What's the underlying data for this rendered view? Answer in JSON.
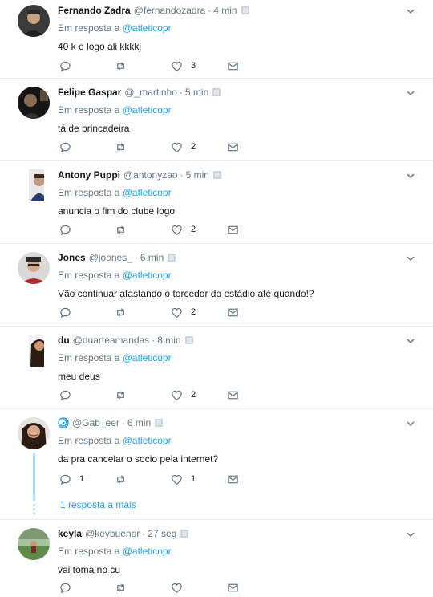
{
  "tweets": [
    {
      "name": "Fernando Zadra",
      "handle": "@fernandozadra",
      "time": "4 min",
      "reply_prefix": "Em resposta a",
      "reply_to": "@atleticopr",
      "text": "40 k e logo ali kkkkj",
      "replies": "",
      "likes": "3"
    },
    {
      "name": "Felipe Gaspar",
      "handle": "@_martinho",
      "time": "5 min",
      "reply_prefix": "Em resposta a",
      "reply_to": "@atleticopr",
      "text": "tá de brincadeira",
      "replies": "",
      "likes": "2"
    },
    {
      "name": "Antony Puppi",
      "handle": "@antonyzao",
      "time": "5 min",
      "reply_prefix": "Em resposta a",
      "reply_to": "@atleticopr",
      "text": "anuncia o fim do clube logo",
      "replies": "",
      "likes": "2"
    },
    {
      "name": "Jones",
      "handle": "@joones_",
      "time": "6 min",
      "reply_prefix": "Em resposta a",
      "reply_to": "@atleticopr",
      "text": "Vão continuar afastando o torcedor do estádio até quando!?",
      "replies": "",
      "likes": "2"
    },
    {
      "name": "du",
      "handle": "@duarteamandas",
      "time": "8 min",
      "reply_prefix": "Em resposta a",
      "reply_to": "@atleticopr",
      "text": "meu deus",
      "replies": "",
      "likes": "2"
    },
    {
      "name": "",
      "handle": "@Gab_eer",
      "time": "6 min",
      "reply_prefix": "Em resposta a",
      "reply_to": "@atleticopr",
      "text": "da pra cancelar o socio pela internet?",
      "replies": "1",
      "likes": "1",
      "more_replies": "1 resposta a mais"
    },
    {
      "name": "keyla",
      "handle": "@keybuenor",
      "time": "27 seg",
      "reply_prefix": "Em resposta a",
      "reply_to": "@atleticopr",
      "text": "vai toma no cu",
      "replies": "",
      "likes": ""
    }
  ],
  "colors": {
    "accent": "#1da1f2",
    "muted": "#657786",
    "thread": "#a9dbfa",
    "divider": "#e6ecf0"
  },
  "icons": {
    "reply": "reply-icon",
    "retweet": "retweet-icon",
    "like": "heart-icon",
    "dm": "envelope-icon",
    "menu": "chevron-down-icon"
  }
}
